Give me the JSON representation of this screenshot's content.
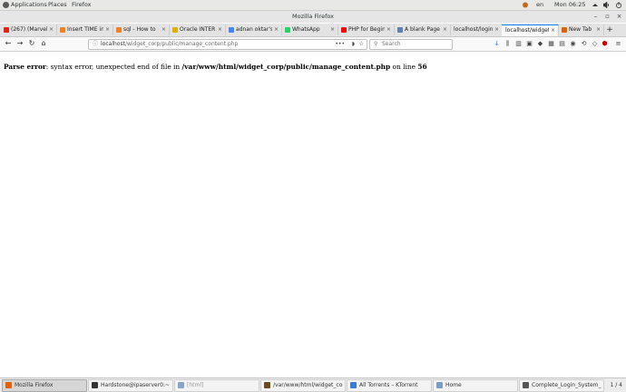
{
  "topbar": {
    "applications": "Applications",
    "places": "Places",
    "firefox": "Firefox",
    "lang": "en",
    "clock": "Mon 06:25"
  },
  "window": {
    "title": "Mozilla Firefox"
  },
  "tabs": [
    {
      "label": "(267) (Marvel",
      "fav_color": "#e62117"
    },
    {
      "label": "Insert TIME in",
      "fav_color": "#f48024"
    },
    {
      "label": "sql - How to",
      "fav_color": "#f48024"
    },
    {
      "label": "Oracle INTER",
      "fav_color": "#e0b000"
    },
    {
      "label": "adnan oktar's",
      "fav_color": "#4285f4"
    },
    {
      "label": "WhatsApp",
      "fav_color": "#25d366"
    },
    {
      "label": "PHP for Begin",
      "fav_color": "#ff0000"
    },
    {
      "label": "A blank Page",
      "fav_color": "#5a7fb5"
    },
    {
      "label": "localhost/login...",
      "fav_color": "#cccccc"
    },
    {
      "label": "localhost/widget",
      "fav_color": "#cccccc"
    },
    {
      "label": "New Tab",
      "fav_color": "#e66000"
    }
  ],
  "nav": {
    "url_host": "localhost",
    "url_path": "/widget_corp/public/manage_content.php",
    "search_placeholder": "Search"
  },
  "error": {
    "label": "Parse error",
    "message": ": syntax error, unexpected end of file in ",
    "file": "/var/www/html/widget_corp/public/manage_content.php",
    "on_line": " on line ",
    "line": "56"
  },
  "taskbar": {
    "items": [
      {
        "label": "Mozilla Firefox",
        "icon_color": "#e66000"
      },
      {
        "label": "Hardstone@ipaserver0:~",
        "icon_color": "#333333"
      },
      {
        "label": "[html]",
        "icon_color": "#8aa4c8"
      },
      {
        "label": "/var/www/html/widget_corp/p...",
        "icon_color": "#6b4b1e"
      },
      {
        "label": "All Torrents – KTorrent",
        "icon_color": "#3b7bd6"
      },
      {
        "label": "Home",
        "icon_color": "#7b9ccb"
      },
      {
        "label": "Complete_Login_System_in_...",
        "icon_color": "#555555"
      }
    ],
    "pager": "1 / 4"
  }
}
